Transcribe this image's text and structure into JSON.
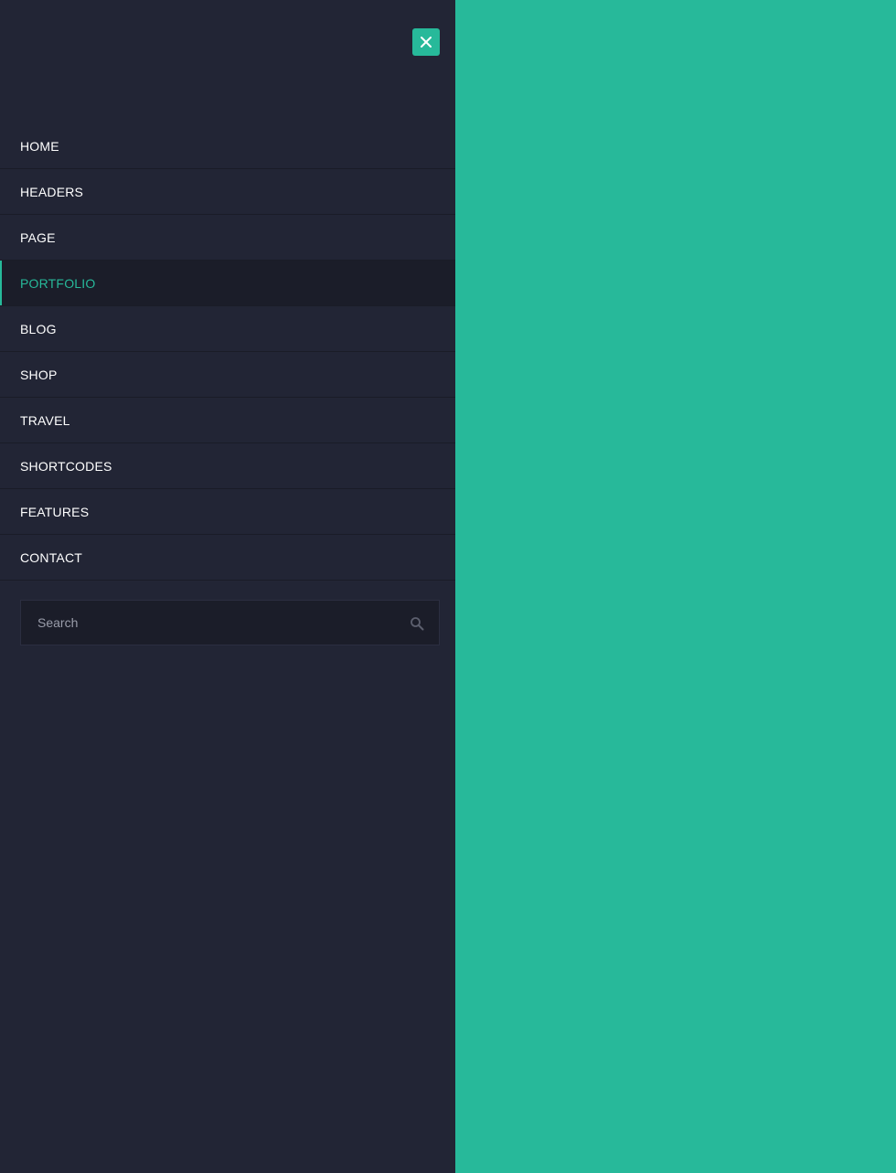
{
  "colors": {
    "accent": "#27b99a",
    "drawer_bg": "#222535",
    "active_bg": "#1b1d29",
    "text": "#ffffff"
  },
  "drawer": {
    "close_icon": "close-icon",
    "nav": {
      "items": [
        {
          "label": "HOME",
          "active": false
        },
        {
          "label": "HEADERS",
          "active": false
        },
        {
          "label": "PAGE",
          "active": false
        },
        {
          "label": "PORTFOLIO",
          "active": true
        },
        {
          "label": "BLOG",
          "active": false
        },
        {
          "label": "SHOP",
          "active": false
        },
        {
          "label": "TRAVEL",
          "active": false
        },
        {
          "label": "SHORTCODES",
          "active": false
        },
        {
          "label": "FEATURES",
          "active": false
        },
        {
          "label": "CONTACT",
          "active": false
        }
      ]
    },
    "search": {
      "placeholder": "Search",
      "value": "",
      "icon": "search-icon"
    }
  }
}
